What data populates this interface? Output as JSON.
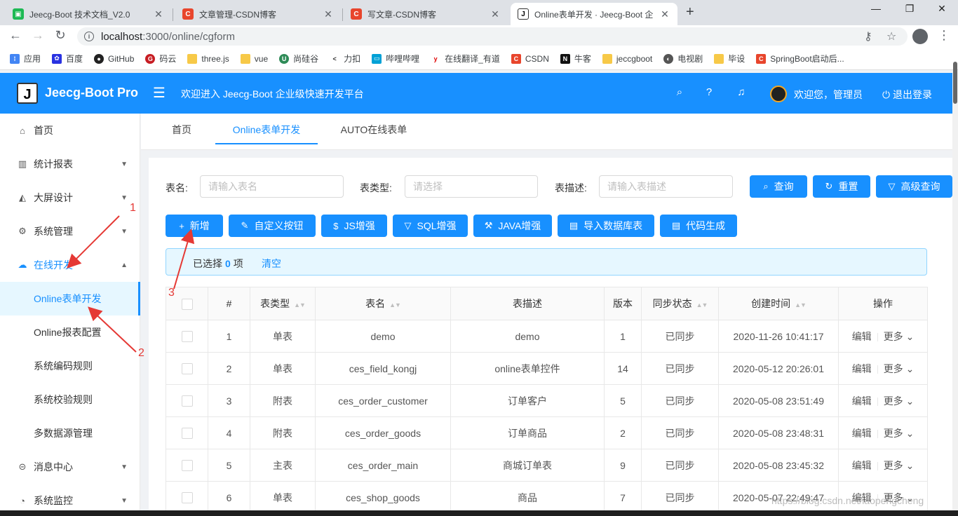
{
  "browser": {
    "tabs": [
      {
        "title": "Jeecg-Boot 技术文档_V2.0",
        "favicon": "doc-icon",
        "color": "#1db954"
      },
      {
        "title": "文章管理-CSDN博客",
        "favicon": "csdn-icon",
        "color": "#e8452c"
      },
      {
        "title": "写文章-CSDN博客",
        "favicon": "csdn-icon",
        "color": "#e8452c"
      },
      {
        "title": "Online表单开发 · Jeecg-Boot 企",
        "favicon": "jeecg-icon",
        "color": "#ffffff"
      }
    ],
    "url_host": "localhost",
    "url_path": ":3000/online/cgform",
    "bookmarks": [
      {
        "label": "应用",
        "icon": "apps-icon",
        "color": "#4285f4"
      },
      {
        "label": "百度",
        "icon": "baidu-icon",
        "color": "#2932e1"
      },
      {
        "label": "GitHub",
        "icon": "github-icon",
        "color": "#222222"
      },
      {
        "label": "码云",
        "icon": "gitee-icon",
        "color": "#c71d23"
      },
      {
        "label": "three.js",
        "icon": "folder-icon",
        "color": "#f7c948"
      },
      {
        "label": "vue",
        "icon": "folder-icon",
        "color": "#f7c948"
      },
      {
        "label": "尚硅谷",
        "icon": "atguigu-icon",
        "color": "#2e8b57"
      },
      {
        "label": "力扣",
        "icon": "leetcode-icon",
        "color": "#333333"
      },
      {
        "label": "哔哩哔哩",
        "icon": "bilibili-icon",
        "color": "#00a1d6"
      },
      {
        "label": "在线翻译_有道",
        "icon": "youdao-icon",
        "color": "#e00000"
      },
      {
        "label": "CSDN",
        "icon": "csdn-icon",
        "color": "#e8452c"
      },
      {
        "label": "牛客",
        "icon": "nowcoder-icon",
        "color": "#111111"
      },
      {
        "label": "jeccgboot",
        "icon": "folder-icon",
        "color": "#f7c948"
      },
      {
        "label": "电视剧",
        "icon": "tv-icon",
        "color": "#555555"
      },
      {
        "label": "毕设",
        "icon": "folder-icon",
        "color": "#f7c948"
      },
      {
        "label": "SpringBoot启动后...",
        "icon": "csdn-icon",
        "color": "#e8452c"
      }
    ]
  },
  "header": {
    "app_name": "Jeecg-Boot Pro",
    "logo_letter": "J",
    "welcome": "欢迎进入 Jeecg-Boot 企业级快速开发平台",
    "user_greeting": "欢迎您，管理员",
    "logout": "退出登录",
    "brand_color": "#1890ff"
  },
  "sidebar": {
    "items": [
      {
        "label": "首页",
        "icon": "home-icon"
      },
      {
        "label": "统计报表",
        "icon": "bar-chart-icon"
      },
      {
        "label": "大屏设计",
        "icon": "area-chart-icon"
      },
      {
        "label": "系统管理",
        "icon": "gear-icon"
      },
      {
        "label": "在线开发",
        "icon": "cloud-icon"
      },
      {
        "label": "Online表单开发"
      },
      {
        "label": "Online报表配置"
      },
      {
        "label": "系统编码规则"
      },
      {
        "label": "系统校验规则"
      },
      {
        "label": "多数据源管理"
      },
      {
        "label": "消息中心",
        "icon": "message-icon"
      },
      {
        "label": "系统监控",
        "icon": "dashboard-icon"
      }
    ]
  },
  "page_tabs": [
    "首页",
    "Online表单开发",
    "AUTO在线表单"
  ],
  "search": {
    "table_name_label": "表名:",
    "table_name_placeholder": "请输入表名",
    "table_type_label": "表类型:",
    "table_type_placeholder": "请选择",
    "table_desc_label": "表描述:",
    "table_desc_placeholder": "请输入表描述",
    "query": "查询",
    "reset": "重置",
    "advanced": "高级查询"
  },
  "toolbar": {
    "add": "新增",
    "custom_button": "自定义按钮",
    "js": "JS增强",
    "sql": "SQL增强",
    "java": "JAVA增强",
    "import_db": "导入数据库表",
    "codegen": "代码生成"
  },
  "selection": {
    "prefix": "已选择",
    "count": "0",
    "suffix": "项",
    "clear": "清空"
  },
  "table": {
    "headers": [
      "#",
      "表类型",
      "表名",
      "表描述",
      "版本",
      "同步状态",
      "创建时间",
      "操作"
    ],
    "rows": [
      {
        "no": "1",
        "type": "单表",
        "name": "demo",
        "desc": "demo",
        "version": "1",
        "sync": "已同步",
        "created": "2020-11-26 10:41:17",
        "edit": "编辑",
        "more": "更多"
      },
      {
        "no": "2",
        "type": "单表",
        "name": "ces_field_kongj",
        "desc": "online表单控件",
        "version": "14",
        "sync": "已同步",
        "created": "2020-05-12 20:26:01",
        "edit": "编辑",
        "more": "更多"
      },
      {
        "no": "3",
        "type": "附表",
        "name": "ces_order_customer",
        "desc": "订单客户",
        "version": "5",
        "sync": "已同步",
        "created": "2020-05-08 23:51:49",
        "edit": "编辑",
        "more": "更多"
      },
      {
        "no": "4",
        "type": "附表",
        "name": "ces_order_goods",
        "desc": "订单商品",
        "version": "2",
        "sync": "已同步",
        "created": "2020-05-08 23:48:31",
        "edit": "编辑",
        "more": "更多"
      },
      {
        "no": "5",
        "type": "主表",
        "name": "ces_order_main",
        "desc": "商城订单表",
        "version": "9",
        "sync": "已同步",
        "created": "2020-05-08 23:45:32",
        "edit": "编辑",
        "more": "更多"
      },
      {
        "no": "6",
        "type": "单表",
        "name": "ces_shop_goods",
        "desc": "商品",
        "version": "7",
        "sync": "已同步",
        "created": "2020-05-07 22:49:47",
        "edit": "编辑",
        "more": "更多"
      }
    ]
  },
  "annotations": [
    "1",
    "2",
    "3"
  ],
  "watermark": "https://blog.csdn.net/laopengcheng",
  "annotation_color": "#e53935"
}
